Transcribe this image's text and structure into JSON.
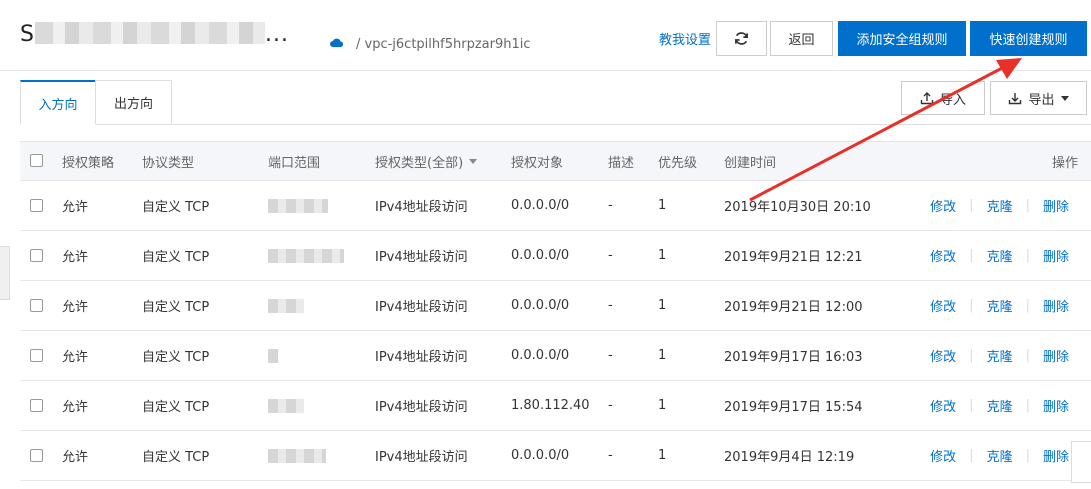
{
  "header": {
    "title_visible": "S",
    "title_tail": "...",
    "vpc": "/ vpc-j6ctpilhf5hrpzar9h1ic",
    "help_link": "教我设置",
    "back_label": "返回",
    "add_rule_label": "添加安全组规则",
    "quick_create_label": "快速创建规则"
  },
  "tabs": [
    {
      "label": "入方向",
      "active": true
    },
    {
      "label": "出方向",
      "active": false
    }
  ],
  "toolbar": {
    "import_label": "导入",
    "export_label": "导出"
  },
  "table": {
    "headers": {
      "policy": "授权策略",
      "protocol": "协议类型",
      "port": "端口范围",
      "auth_type": "授权类型(全部)",
      "object": "授权对象",
      "desc": "描述",
      "priority": "优先级",
      "created": "创建时间",
      "ops": "操作"
    },
    "rows": [
      {
        "policy": "允许",
        "protocol": "自定义 TCP",
        "auth_type": "IPv4地址段访问",
        "object": "0.0.0.0/0",
        "desc": "-",
        "priority": "1",
        "created": "2019年10月30日 20:10"
      },
      {
        "policy": "允许",
        "protocol": "自定义 TCP",
        "auth_type": "IPv4地址段访问",
        "object": "0.0.0.0/0",
        "desc": "-",
        "priority": "1",
        "created": "2019年9月21日 12:21"
      },
      {
        "policy": "允许",
        "protocol": "自定义 TCP",
        "auth_type": "IPv4地址段访问",
        "object": "0.0.0.0/0",
        "desc": "-",
        "priority": "1",
        "created": "2019年9月21日 12:00"
      },
      {
        "policy": "允许",
        "protocol": "自定义 TCP",
        "auth_type": "IPv4地址段访问",
        "object": "0.0.0.0/0",
        "desc": "-",
        "priority": "1",
        "created": "2019年9月17日 16:03"
      },
      {
        "policy": "允许",
        "protocol": "自定义 TCP",
        "auth_type": "IPv4地址段访问",
        "object": "1.80.112.40",
        "desc": "-",
        "priority": "1",
        "created": "2019年9月17日 15:54"
      },
      {
        "policy": "允许",
        "protocol": "自定义 TCP",
        "auth_type": "IPv4地址段访问",
        "object": "0.0.0.0/0",
        "desc": "-",
        "priority": "1",
        "created": "2019年9月4日 12:19"
      }
    ],
    "row_actions": {
      "edit": "修改",
      "clone": "克隆",
      "delete": "删除"
    }
  },
  "colors": {
    "primary": "#0070cc",
    "annotation_arrow": "#e8302a"
  },
  "icons": {
    "refresh": "refresh-icon",
    "import": "upload-icon",
    "export": "download-icon",
    "cloud": "cloud-icon"
  }
}
